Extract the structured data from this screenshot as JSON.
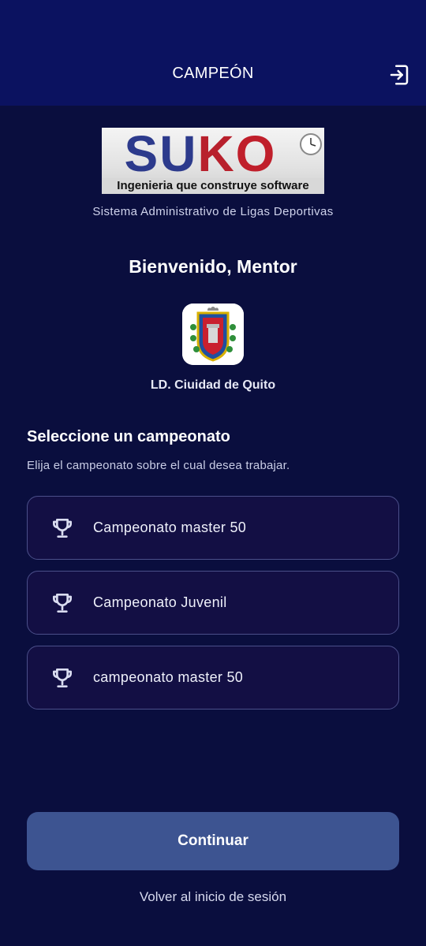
{
  "header": {
    "title": "CAMPEÓN",
    "logout_icon": "logout-icon"
  },
  "brand": {
    "logo_letters": [
      "S",
      "U",
      "K",
      "O"
    ],
    "logo_tagline": "Ingenieria que construye software",
    "subtitle": "Sistema Administrativo de Ligas Deportivas"
  },
  "welcome": {
    "greeting": "Bienvenido, Mentor",
    "league_name": "LD. Ciuidad de Quito"
  },
  "selection": {
    "title": "Seleccione un campeonato",
    "description": "Elija el campeonato sobre el cual desea trabajar.",
    "items": [
      {
        "label": "Campeonato master 50",
        "icon": "trophy-icon"
      },
      {
        "label": "Campeonato Juvenil",
        "icon": "trophy-icon"
      },
      {
        "label": "campeonato master 50",
        "icon": "trophy-icon"
      }
    ]
  },
  "actions": {
    "continue_label": "Continuar",
    "back_label": "Volver al inicio de sesión"
  },
  "colors": {
    "background": "#0a0e3e",
    "header": "#0b1260",
    "card": "#130f44",
    "card_border": "#4b4f8a",
    "button": "#3d5491"
  }
}
